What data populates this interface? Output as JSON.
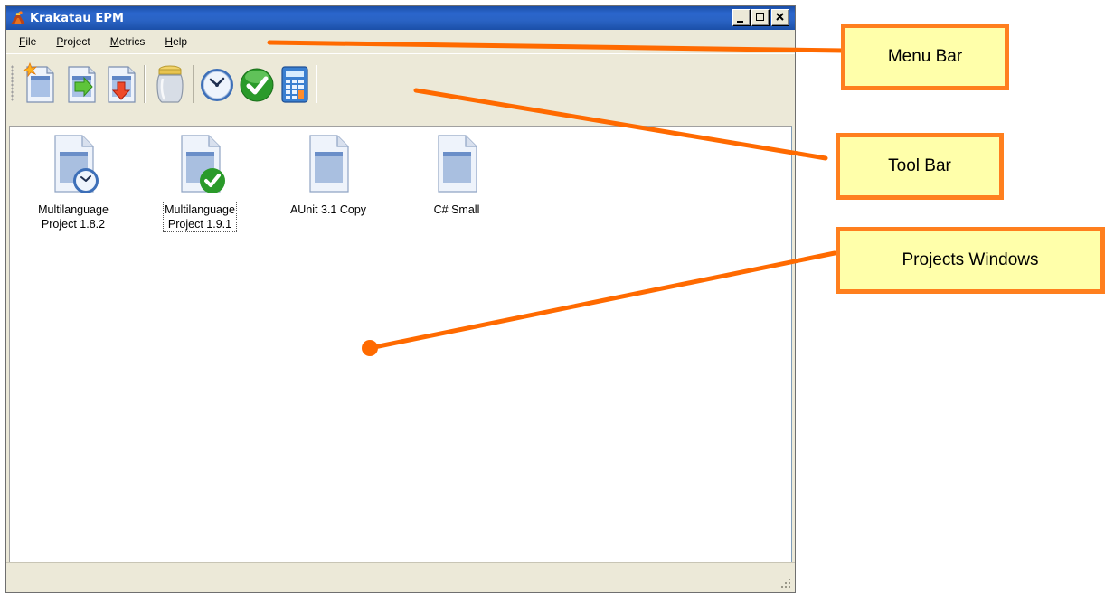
{
  "window": {
    "title": "Krakatau EPM",
    "controls": [
      "minimize-icon",
      "maximize-icon",
      "close-icon"
    ]
  },
  "menubar": {
    "items": [
      {
        "label": "File",
        "accel": "F"
      },
      {
        "label": "Project",
        "accel": "P"
      },
      {
        "label": "Metrics",
        "accel": "M"
      },
      {
        "label": "Help",
        "accel": "H"
      }
    ]
  },
  "toolbar": {
    "buttons": [
      {
        "icon": "new-project-icon"
      },
      {
        "icon": "import-project-icon"
      },
      {
        "icon": "export-project-icon"
      },
      {
        "icon": "jar-icon"
      },
      {
        "icon": "clock-icon"
      },
      {
        "icon": "checkmark-icon"
      },
      {
        "icon": "calculator-icon"
      }
    ]
  },
  "projects": {
    "items": [
      {
        "label_line1": "Multilanguage",
        "label_line2": "Project 1.8.2",
        "badge": "clock-badge",
        "selected": false
      },
      {
        "label_line1": "Multilanguage",
        "label_line2": "Project 1.9.1",
        "badge": "check-badge",
        "selected": true
      },
      {
        "label_line1": "AUnit 3.1 Copy",
        "label_line2": "",
        "badge": "none",
        "selected": false
      },
      {
        "label_line1": "C# Small",
        "label_line2": "",
        "badge": "none",
        "selected": false
      }
    ]
  },
  "callouts": {
    "menu_bar": "Menu Bar",
    "tool_bar": "Tool Bar",
    "projects_windows": "Projects Windows"
  },
  "colors": {
    "callout_border": "#ff7f1e",
    "callout_fill": "#ffffaa",
    "arrow": "#ff6a00",
    "titlebar": "#2a63c4"
  }
}
